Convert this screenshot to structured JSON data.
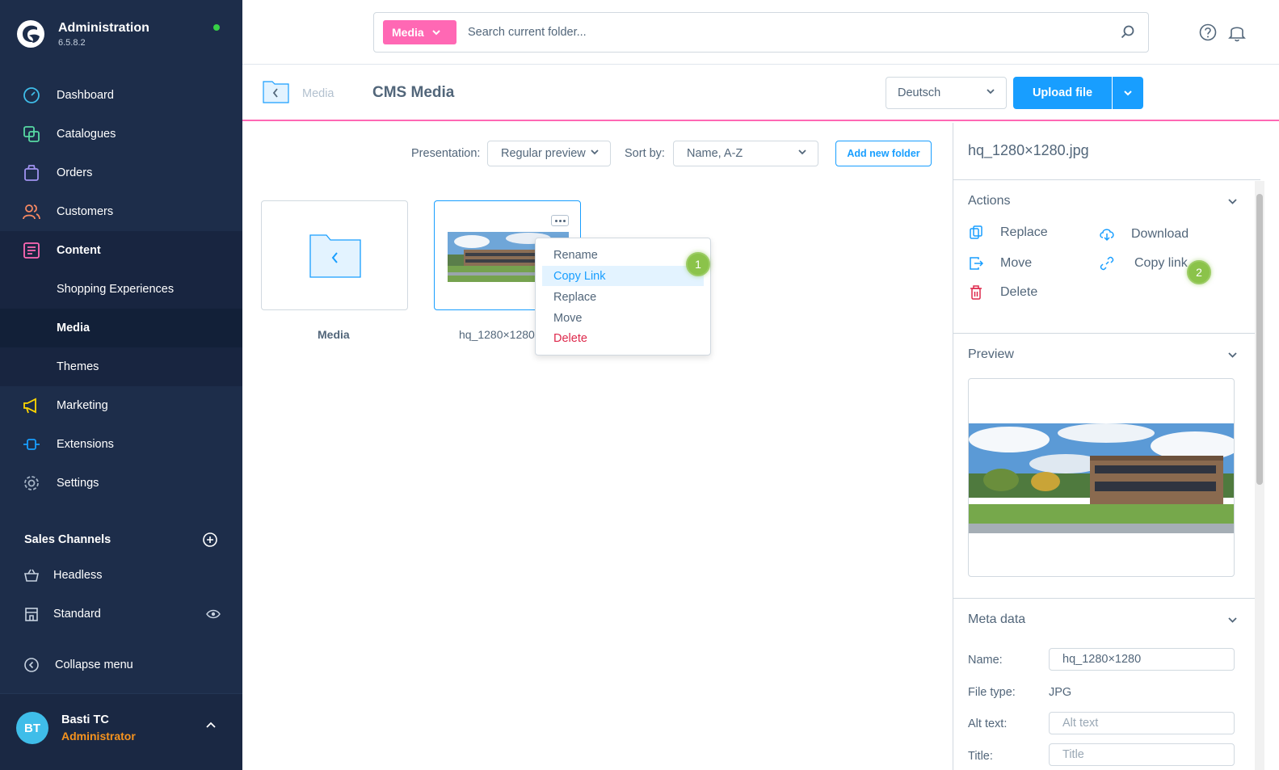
{
  "app": {
    "title": "Administration",
    "version": "6.5.8.2"
  },
  "nav": {
    "dashboard": "Dashboard",
    "catalogues": "Catalogues",
    "orders": "Orders",
    "customers": "Customers",
    "content": "Content",
    "content_sub": [
      "Shopping Experiences",
      "Media",
      "Themes"
    ],
    "marketing": "Marketing",
    "extensions": "Extensions",
    "settings": "Settings"
  },
  "sales_channels": {
    "title": "Sales Channels",
    "items": [
      "Headless",
      "Standard"
    ]
  },
  "collapse_label": "Collapse menu",
  "user": {
    "initials": "BT",
    "name": "Basti TC",
    "role": "Administrator"
  },
  "search": {
    "chip": "Media",
    "placeholder": "Search current folder..."
  },
  "page": {
    "breadcrumb": "Media",
    "title": "CMS Media",
    "language": "Deutsch",
    "upload_label": "Upload file"
  },
  "toolbar": {
    "presentation_label": "Presentation:",
    "presentation_value": "Regular preview",
    "sort_label": "Sort by:",
    "sort_value": "Name, A-Z",
    "add_folder": "Add new folder"
  },
  "tiles": [
    {
      "label": "Media"
    },
    {
      "label": "hq_1280×1280"
    }
  ],
  "context_menu": [
    "Rename",
    "Copy Link",
    "Replace",
    "Move",
    "Delete"
  ],
  "badges": [
    "1",
    "2"
  ],
  "sidebar_detail": {
    "filename": "hq_1280×1280.jpg",
    "actions_title": "Actions",
    "actions": {
      "replace": "Replace",
      "download": "Download",
      "move": "Move",
      "copy_link": "Copy link",
      "delete": "Delete"
    },
    "preview_title": "Preview",
    "meta_title": "Meta data",
    "meta": {
      "name_label": "Name:",
      "name_value": "hq_1280×1280",
      "filetype_label": "File type:",
      "filetype_value": "JPG",
      "alt_label": "Alt text:",
      "alt_placeholder": "Alt text",
      "title_label": "Title:",
      "title_placeholder": "Title"
    }
  },
  "colors": {
    "sidebar": "#1d2d4a",
    "accent": "#189eff",
    "pink": "#ff68b4",
    "danger": "#de294c",
    "badge": "#8bc34a"
  }
}
